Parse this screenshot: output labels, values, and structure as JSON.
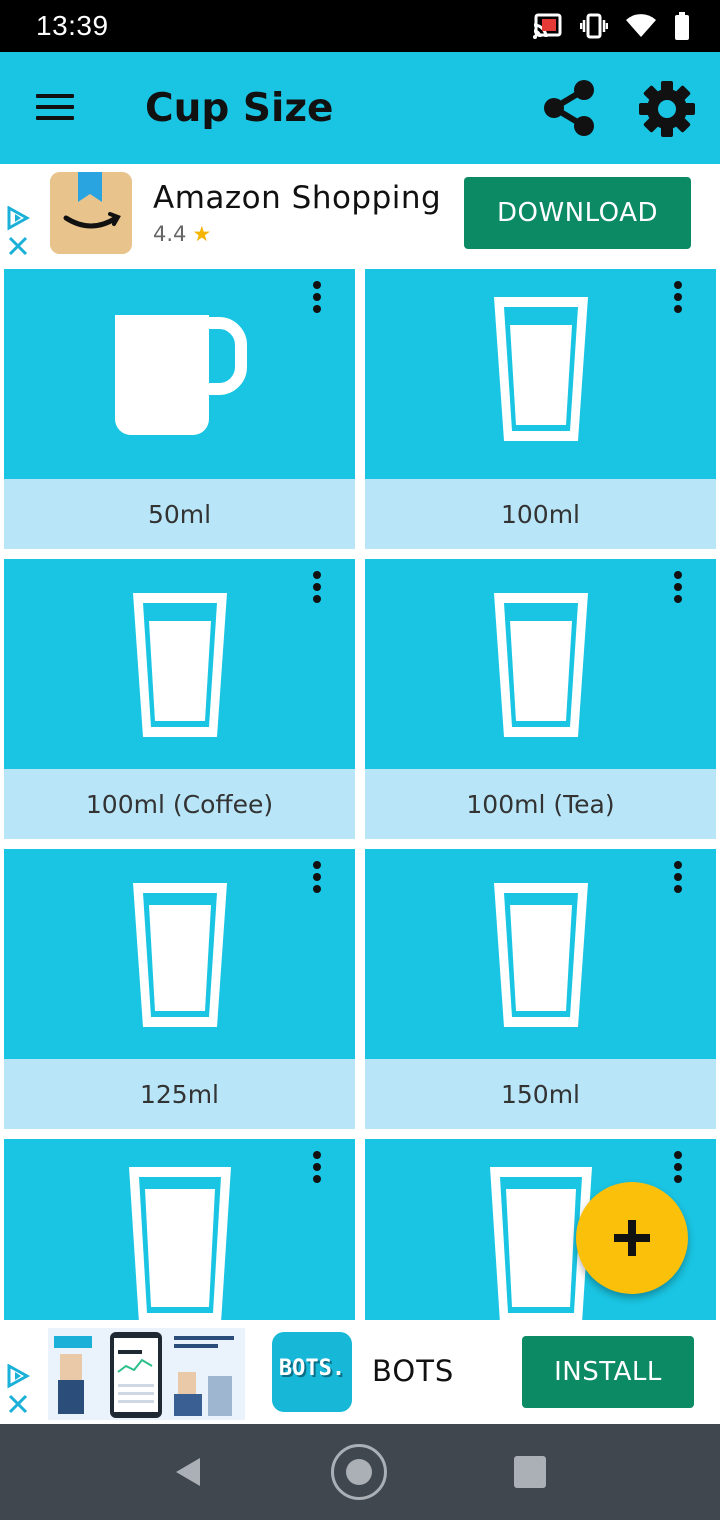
{
  "status_bar": {
    "time": "13:39"
  },
  "app_bar": {
    "title": "Cup Size"
  },
  "ad_top": {
    "app_name": "Amazon Shopping",
    "rating": "4.4",
    "rating_star": "★",
    "button": "DOWNLOAD"
  },
  "cups": [
    {
      "label": "50ml",
      "icon": "mug-icon"
    },
    {
      "label": "100ml",
      "icon": "glass-icon"
    },
    {
      "label": "100ml (Coffee)",
      "icon": "glass-icon"
    },
    {
      "label": "100ml (Tea)",
      "icon": "glass-icon"
    },
    {
      "label": "125ml",
      "icon": "glass-icon"
    },
    {
      "label": "150ml",
      "icon": "glass-icon"
    },
    {
      "label": "",
      "icon": "glass-icon"
    },
    {
      "label": "",
      "icon": "glass-icon"
    }
  ],
  "fab": {
    "icon": "plus-icon"
  },
  "ad_bottom": {
    "app_name": "BOTS",
    "icon_text": "BOTS.",
    "button": "INSTALL"
  },
  "colors": {
    "accent": "#1ac5e3",
    "label_bg": "#b8e6f8",
    "fab": "#fbc00a",
    "ad_button": "#0c8a64"
  }
}
